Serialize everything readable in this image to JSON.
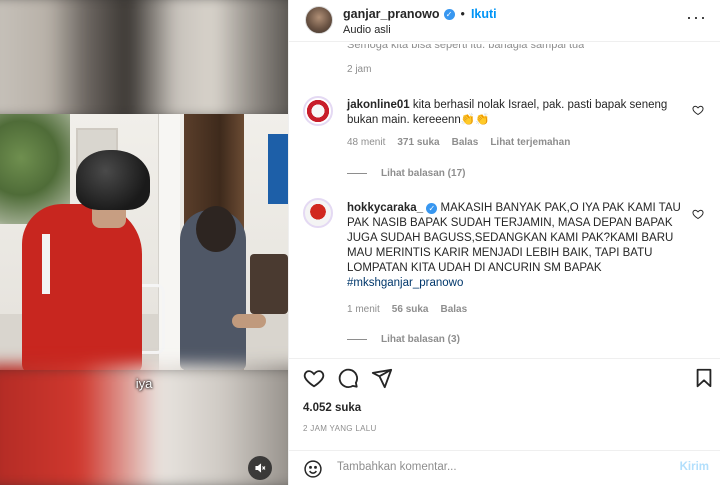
{
  "video": {
    "caption": "iya",
    "mute_icon": "speaker-muted-icon"
  },
  "header": {
    "username": "ganjar_pranowo",
    "separator": "•",
    "follow_label": "Ikuti",
    "audio": "Audio asli",
    "more_icon": "more-options-icon"
  },
  "previous_comment": {
    "cut_text": "Semoga kita bisa seperti itu. bahagia sampai tua",
    "time": "2 jam"
  },
  "comments": [
    {
      "username": "jakonline01",
      "text": "kita berhasil nolak Israel, pak. pasti bapak seneng bukan main. kereeenn👏👏",
      "time": "48 menit",
      "likes": "371 suka",
      "reply": "Balas",
      "translate": "Lihat terjemahan",
      "view_replies": "Lihat balasan (17)"
    },
    {
      "username": "hokkycaraka_",
      "verified": true,
      "text": "MAKASIH BANYAK PAK,O IYA PAK KAMI TAU PAK NASIB BAPAK SUDAH TERJAMIN, MASA DEPAN BAPAK JUGA SUDAH BAGUSS,SEDANGKAN KAMI PAK?KAMI BARU MAU MERINTIS KARIR MENJADI LEBIH BAIK, TAPI BATU LOMPATAN KITA UDAH DI ANCURIN SM BAPAK",
      "hashtag": "#mkshganjar_pranowo",
      "time": "1 menit",
      "likes": "56 suka",
      "reply": "Balas",
      "view_replies": "Lihat balasan (3)"
    }
  ],
  "actions": {
    "like_icon": "heart-icon",
    "comment_icon": "comment-icon",
    "share_icon": "share-icon",
    "save_icon": "bookmark-icon"
  },
  "likes": "4.052 suka",
  "posted": "2 JAM YANG LALU",
  "composer": {
    "placeholder": "Tambahkan komentar...",
    "send_label": "Kirim",
    "emoji_icon": "emoji-icon"
  },
  "colors": {
    "accent": "#0095f6",
    "verified": "#3897f0",
    "muted_text": "#8e8e8e",
    "send_disabled": "#b2dffc"
  }
}
